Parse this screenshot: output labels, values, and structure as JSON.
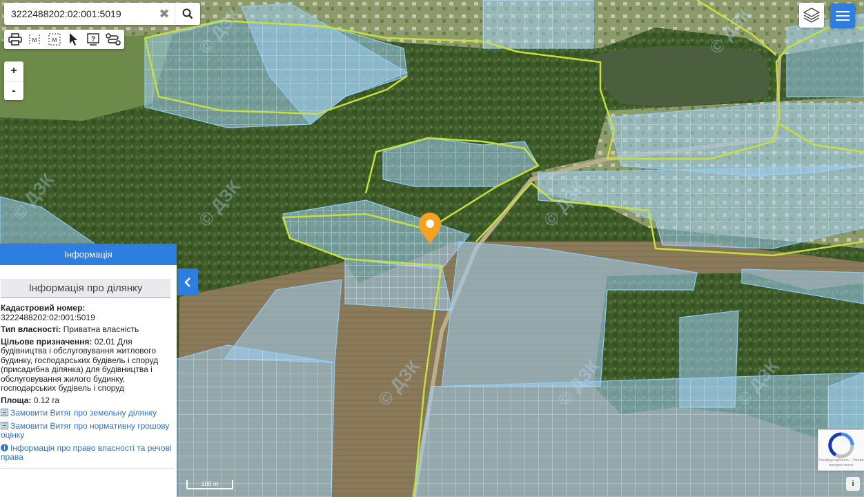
{
  "search": {
    "value": "3222488202:02:001:5019",
    "clear_icon": "close-icon",
    "search_icon": "search-icon"
  },
  "toolbar": {
    "tools": [
      "print-icon",
      "measure-distance-icon",
      "measure-area-icon",
      "pointer-icon",
      "help-icon",
      "route-icon"
    ],
    "measure_label": "M",
    "measure_area_label": "M",
    "help_label": "?"
  },
  "zoom": {
    "in_label": "+",
    "out_label": "-"
  },
  "map": {
    "marker_icon": "location-pin-icon",
    "watermark": "© ДЗК",
    "scale_label": "100 m"
  },
  "panel": {
    "header": "Інформація",
    "subheader": "Інформація про ділянку",
    "cadastral_label": "Кадастровий номер:",
    "cadastral_value": "3222488202:02:001:5019",
    "ownership_label": "Тип власності:",
    "ownership_value": "Приватна власність",
    "purpose_label": "Цільове призначення:",
    "purpose_value": "02.01 Для будівництва і обслуговування житлового будинку, господарських будівель і споруд (присадибна ділянка) для будівництва і обслуговування жилого будинку, господарських будівель і споруд",
    "area_label": "Площа:",
    "area_value": "0.12 га",
    "link_extract": "Замовити Витяг про земельну ділянку",
    "link_valuation": "Замовити Витяг про нормативну грошову оцінку",
    "link_rights": "Інформація про право власності та речові права"
  },
  "recaptcha": {
    "text": "Конфіденційність - Умови використання"
  },
  "colors": {
    "accent": "#2e7de1",
    "parcel_fill": "#9fd0f2",
    "parcel_stroke": "#7ec2ee",
    "boundary": "#c6e03c",
    "marker": "#f4a21f"
  }
}
